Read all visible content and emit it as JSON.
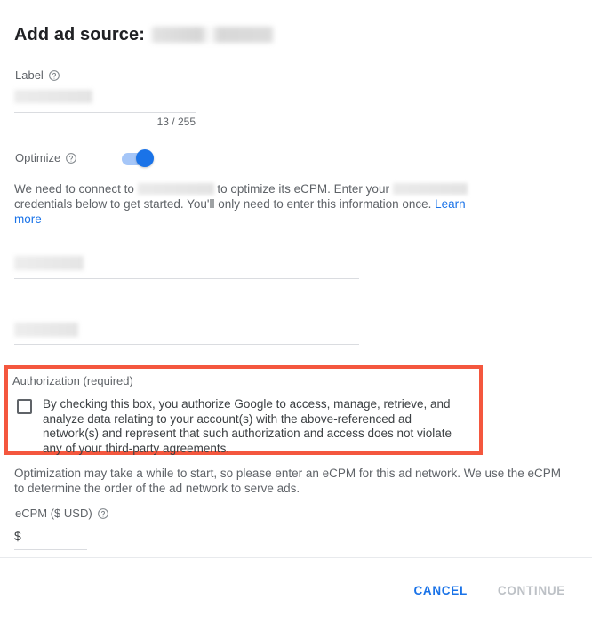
{
  "dialog": {
    "title_prefix": "Add ad source:",
    "title_redacted": true
  },
  "label_field": {
    "label": "Label",
    "help_icon": "help-circle-icon",
    "value_redacted": true,
    "counter": "13 / 255",
    "max_length": 255,
    "current_length": 13
  },
  "optimize": {
    "label": "Optimize",
    "help_icon": "help-circle-icon",
    "enabled": true,
    "toggle_on_color": "#1a73e8",
    "toggle_track_color": "#a5c6f8"
  },
  "connect_notice": {
    "part1": "We need to connect to",
    "part2": "to optimize its eCPM. Enter your",
    "part3": "credentials below to get started. You'll only need to enter this information once.",
    "link_text": "Learn more",
    "link_color": "#1a73e8"
  },
  "credentials": {
    "field1_redacted": true,
    "field2_redacted": true
  },
  "authorization": {
    "section_label": "Authorization (required)",
    "checked": false,
    "consent_text": "By checking this box, you authorize Google to access, manage, retrieve, and analyze data relating to your account(s) with the above-referenced ad network(s) and represent that such authorization and access does not violate any of your third-party agreements.",
    "highlight_color": "#f4573e"
  },
  "optimization_note": "Optimization may take a while to start, so please enter an eCPM for this ad network. We use the eCPM to determine the order of the ad network to serve ads.",
  "ecpm_field": {
    "label": "eCPM ($ USD)",
    "help_icon": "help-circle-icon",
    "prefix": "$",
    "value": ""
  },
  "footer": {
    "cancel_label": "CANCEL",
    "continue_label": "CONTINUE",
    "continue_enabled": false
  }
}
